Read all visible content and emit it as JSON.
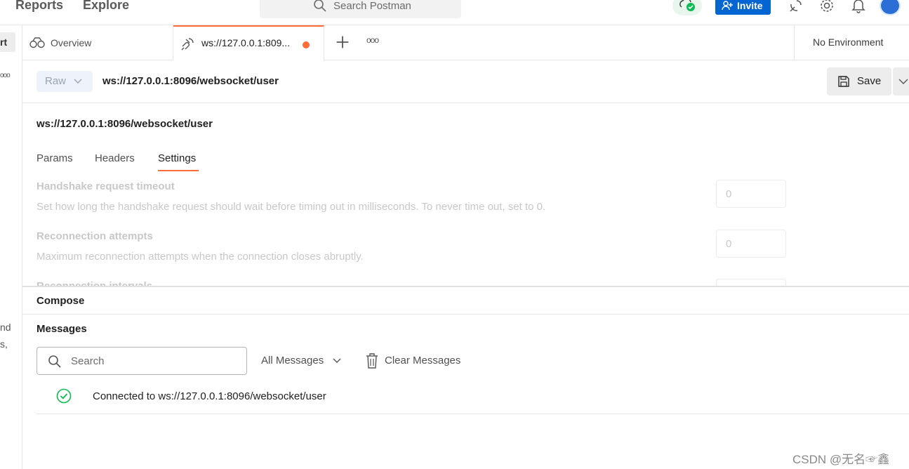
{
  "header": {
    "nav": [
      "Reports",
      "Explore"
    ],
    "search_placeholder": "Search Postman",
    "invite_label": "Invite"
  },
  "sidebar": {
    "button_label": "rt",
    "dots": "ooo",
    "text_fragments": [
      "nd",
      "s,"
    ]
  },
  "tabs": {
    "overview_label": "Overview",
    "active_label": "ws://127.0.0.1:809...",
    "more": "ooo",
    "environment": "No Environment"
  },
  "request": {
    "mode": "Raw",
    "url": "ws://127.0.0.1:8096/websocket/user",
    "save_label": "Save",
    "name": "ws://127.0.0.1:8096/websocket/user",
    "subtabs": [
      "Params",
      "Headers",
      "Settings"
    ],
    "active_subtab": "Settings"
  },
  "settings": [
    {
      "title": "Handshake request timeout",
      "description": "Set how long the handshake request should wait before timing out in milliseconds. To never time out, set to 0.",
      "value": "0"
    },
    {
      "title": "Reconnection attempts",
      "description": "Maximum reconnection attempts when the connection closes abruptly.",
      "value": "0"
    },
    {
      "title": "Reconnection intervals",
      "value": ""
    }
  ],
  "compose": {
    "title": "Compose"
  },
  "messages": {
    "title": "Messages",
    "search_placeholder": "Search",
    "filter_label": "All Messages",
    "clear_label": "Clear Messages",
    "items": [
      {
        "status": "connected",
        "text": "Connected to ws://127.0.0.1:8096/websocket/user"
      }
    ]
  },
  "watermark": "CSDN @无名☞鑫",
  "colors": {
    "accent": "#ff6c37",
    "invite_blue": "#0265d2",
    "success_green": "#0cbb52"
  }
}
